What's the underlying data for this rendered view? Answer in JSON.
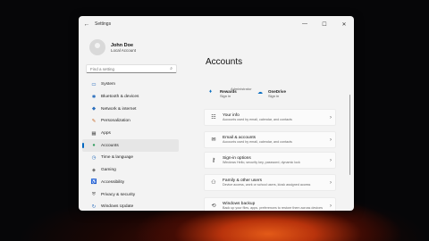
{
  "window": {
    "title": "Settings",
    "back_glyph": "←",
    "minimize_glyph": "—",
    "maximize_glyph": "☐",
    "close_glyph": "✕"
  },
  "user": {
    "name": "John Doe",
    "subtitle": "Local Account"
  },
  "search": {
    "placeholder": "Find a setting",
    "icon": "search-icon",
    "icon_glyph": "⌕"
  },
  "sidebar": {
    "accent_color": "#0067c0",
    "items": [
      {
        "label": "System",
        "icon": "system-icon",
        "glyph": "▭",
        "color": "#2a6ebd"
      },
      {
        "label": "Bluetooth & devices",
        "icon": "bluetooth-icon",
        "glyph": "✱",
        "color": "#2a6ebd"
      },
      {
        "label": "Network & internet",
        "icon": "wifi-icon",
        "glyph": "◆",
        "color": "#2a6ebd"
      },
      {
        "label": "Personalization",
        "icon": "brush-icon",
        "glyph": "✎",
        "color": "#c86b2b"
      },
      {
        "label": "Apps",
        "icon": "apps-icon",
        "glyph": "▦",
        "color": "#555555"
      },
      {
        "label": "Accounts",
        "icon": "person-icon",
        "glyph": "●",
        "color": "#2a9a5a"
      },
      {
        "label": "Time & language",
        "icon": "clock-icon",
        "glyph": "◷",
        "color": "#2a6ebd"
      },
      {
        "label": "Gaming",
        "icon": "gaming-icon",
        "glyph": "◈",
        "color": "#555555"
      },
      {
        "label": "Accessibility",
        "icon": "accessibility-icon",
        "glyph": "♿",
        "color": "#2a6ebd"
      },
      {
        "label": "Privacy & security",
        "icon": "shield-icon",
        "glyph": "⛨",
        "color": "#555555"
      },
      {
        "label": "Windows Update",
        "icon": "update-icon",
        "glyph": "↻",
        "color": "#2a6ebd"
      }
    ]
  },
  "content": {
    "title": "Accounts",
    "role": "Administrator",
    "services": [
      {
        "title": "Rewards",
        "sub": "Sign in",
        "icon": "rewards-icon",
        "glyph": "♦"
      },
      {
        "title": "OneDrive",
        "sub": "Sign in",
        "icon": "onedrive-icon",
        "glyph": "☁"
      }
    ],
    "cards": [
      {
        "title": "Your info",
        "desc": "Accounts used by email, calendar, and contacts",
        "icon": "id-card-icon",
        "glyph": "☷"
      },
      {
        "title": "Email & accounts",
        "desc": "Accounts used by email, calendar, and contacts",
        "icon": "mail-icon",
        "glyph": "✉"
      },
      {
        "title": "Sign-in options",
        "desc": "Windows Hello, security key, password, dynamic lock",
        "icon": "key-icon",
        "glyph": "⚷"
      },
      {
        "title": "Family & other users",
        "desc": "Device access, work or school users, kiosk assigned access",
        "icon": "people-icon",
        "glyph": "⚇"
      },
      {
        "title": "Windows backup",
        "desc": "Back up your files, apps, preferences to restore them across devices",
        "icon": "backup-icon",
        "glyph": "⟲"
      }
    ],
    "chevron": "›"
  }
}
